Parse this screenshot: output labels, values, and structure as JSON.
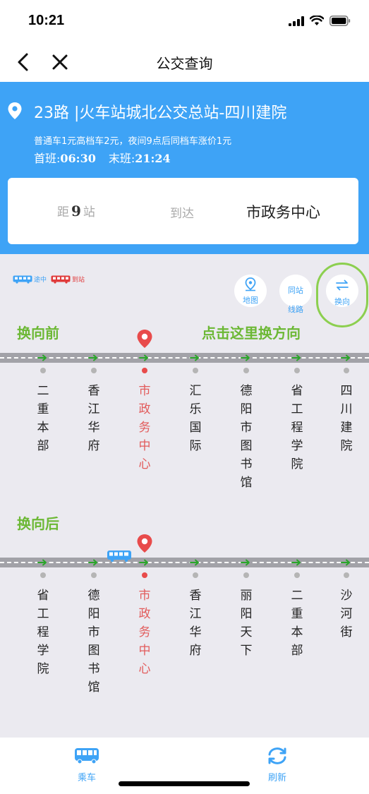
{
  "status": {
    "time": "10:21"
  },
  "nav": {
    "title": "公交查询"
  },
  "route": {
    "name": "23路 |火车站城北公交总站-四川建院",
    "price": "普通车1元高档车2元，夜间9点后同档车涨价1元",
    "first_label": "首班:",
    "first_time": "06:30",
    "last_label": "末班:",
    "last_time": "21:24"
  },
  "arrival": {
    "dist_prefix": "距",
    "dist_count": "9",
    "dist_suffix": "站",
    "arrive_label": "到达",
    "stop": "市政务中心"
  },
  "legend": {
    "on_way": "途中",
    "arrived": "到站"
  },
  "actions": {
    "map": "地图",
    "same_station_1": "同站",
    "same_station_2": "线路",
    "swap": "换向"
  },
  "annotations": {
    "before": "换向前",
    "tap_here": "点击这里换方向",
    "after": "换向后"
  },
  "before_stops": [
    {
      "name": "二重本部",
      "current": false
    },
    {
      "name": "香江华府",
      "current": false
    },
    {
      "name": "市政务中心",
      "current": true
    },
    {
      "name": "汇乐国际",
      "current": false
    },
    {
      "name": "德阳市图书馆",
      "current": false
    },
    {
      "name": "省工程学院",
      "current": false
    },
    {
      "name": "四川建院",
      "current": false
    }
  ],
  "after_stops": [
    {
      "name": "省工程学院",
      "current": false
    },
    {
      "name": "德阳市图书馆",
      "current": false
    },
    {
      "name": "市政务中心",
      "current": true
    },
    {
      "name": "香江华府",
      "current": false
    },
    {
      "name": "丽阳天下",
      "current": false
    },
    {
      "name": "二重本部",
      "current": false
    },
    {
      "name": "沙河街",
      "current": false
    }
  ],
  "tabs": {
    "ride": "乘车",
    "refresh": "刷新"
  },
  "colors": {
    "primary": "#3ea3f6",
    "accent_red": "#e84b4b",
    "annotation_green": "#6cb835"
  }
}
